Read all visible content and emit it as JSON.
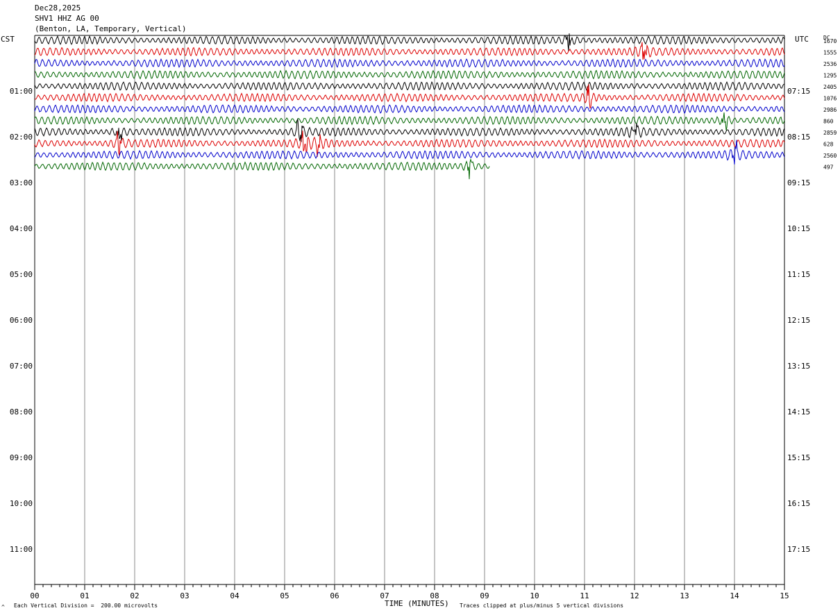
{
  "header": {
    "date": "Dec28,2025",
    "station": "SHV1 HHZ AG 00",
    "location": "(Benton, LA, Temporary, Vertical)"
  },
  "left_timezone": "CST",
  "right_timezone": "UTC",
  "dc_label": "DC",
  "footer": {
    "scale_note": "Each Vertical Division =  200.00 microvolts",
    "clip_note": "Traces clipped at plus/minus 5 vertical divisions",
    "corner_mark": "^"
  },
  "colors": {
    "trace_cycle": [
      "#000000",
      "#dd0000",
      "#0000cc",
      "#006600"
    ],
    "grid": "#888888"
  },
  "chart_data": {
    "type": "line",
    "title": "",
    "xlabel": "TIME (MINUTES)",
    "ylabel": "",
    "xlim": [
      0,
      15
    ],
    "x_ticks": [
      "00",
      "01",
      "02",
      "03",
      "04",
      "05",
      "06",
      "07",
      "08",
      "09",
      "10",
      "11",
      "12",
      "13",
      "14",
      "15"
    ],
    "cst_hour_labels": [
      "01:00",
      "02:00",
      "03:00",
      "04:00",
      "05:00",
      "06:00",
      "07:00",
      "08:00",
      "09:00",
      "10:00",
      "11:00"
    ],
    "utc_hour_labels": [
      "07:15",
      "08:15",
      "09:15",
      "10:15",
      "11:15",
      "12:15",
      "13:15",
      "14:15",
      "15:15",
      "16:15",
      "17:15"
    ],
    "trace_rows": [
      {
        "dc": "1670",
        "end_minute": 15,
        "event_minutes": [
          10.7
        ]
      },
      {
        "dc": "1555",
        "end_minute": 15,
        "event_minutes": [
          12.2
        ]
      },
      {
        "dc": "2536",
        "end_minute": 15,
        "event_minutes": []
      },
      {
        "dc": "1295",
        "end_minute": 15,
        "event_minutes": []
      },
      {
        "dc": "2405",
        "end_minute": 15,
        "event_minutes": []
      },
      {
        "dc": "1076",
        "end_minute": 15,
        "event_minutes": [
          11.1
        ]
      },
      {
        "dc": "2986",
        "end_minute": 15,
        "event_minutes": []
      },
      {
        "dc": "860",
        "end_minute": 15,
        "event_minutes": [
          13.8
        ]
      },
      {
        "dc": "2859",
        "end_minute": 15,
        "event_minutes": [
          1.7,
          5.3,
          12.0
        ]
      },
      {
        "dc": "628",
        "end_minute": 15,
        "event_minutes": [
          1.7,
          5.4,
          5.7
        ]
      },
      {
        "dc": "2560",
        "end_minute": 15,
        "event_minutes": [
          14.0
        ]
      },
      {
        "dc": "497",
        "end_minute": 9.1,
        "event_minutes": [
          8.7
        ]
      }
    ]
  }
}
